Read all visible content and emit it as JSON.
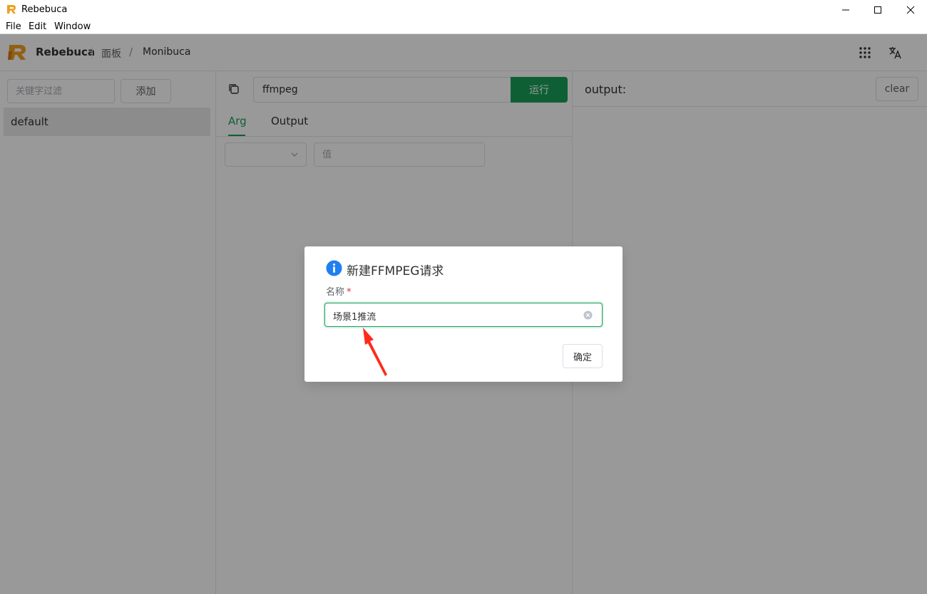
{
  "window": {
    "title": "Rebebuca",
    "controls": [
      "minimize-icon",
      "maximize-icon",
      "close-icon"
    ]
  },
  "menubar": {
    "items": [
      "File",
      "Edit",
      "Window"
    ]
  },
  "header": {
    "brand": "Rebebuca",
    "breadcrumb": [
      "面板",
      "/",
      "Monibuca"
    ],
    "icons": [
      "grid-icon",
      "translate-icon"
    ]
  },
  "left": {
    "filter_placeholder": "关键字过滤",
    "add_label": "添加",
    "items": [
      "default"
    ]
  },
  "middle": {
    "command_value": "ffmpeg",
    "run_label": "运行",
    "tabs": [
      "Arg",
      "Output"
    ],
    "active_tab": "Arg",
    "value_placeholder": "值"
  },
  "right": {
    "output_label": "output:",
    "clear_label": "clear"
  },
  "dialog": {
    "title": "新建FFMPEG请求",
    "name_label": "名称",
    "required_mark": "*",
    "name_value": "场景1推流",
    "confirm_label": "确定"
  },
  "colors": {
    "accent": "#18a058",
    "info": "#2080f0",
    "annotation": "#ff2a1a",
    "logo": "#f0a020"
  }
}
